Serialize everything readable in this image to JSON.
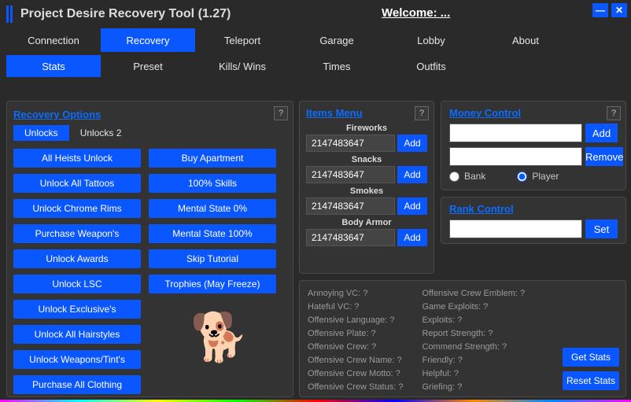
{
  "titlebar": {
    "title": "Project Desire Recovery Tool (1.27)",
    "welcome": "Welcome: ..."
  },
  "win": {
    "min": "—",
    "close": "✕"
  },
  "mainTabs": [
    "Connection",
    "Recovery",
    "Teleport",
    "Garage",
    "Lobby",
    "About"
  ],
  "mainActive": 1,
  "subTabs": [
    "Stats",
    "Preset",
    "Kills/ Wins",
    "Times",
    "Outfits"
  ],
  "subActive": 0,
  "recovery": {
    "title": "Recovery Options",
    "innerTabs": [
      "Unlocks",
      "Unlocks 2"
    ],
    "innerActive": 0,
    "col1": [
      "All Heists Unlock",
      "Unlock All Tattoos",
      "Unlock Chrome Rims",
      "Purchase Weapon's",
      "Unlock Awards",
      "Unlock LSC",
      "Unlock Exclusive's",
      "Unlock All Hairstyles",
      "Unlock Weapons/Tint's",
      "Purchase All Clothing"
    ],
    "col2": [
      "Buy Apartment",
      "100% Skills",
      "Mental State 0%",
      "Mental State 100%",
      "Skip Tutorial",
      "Trophies (May Freeze)"
    ]
  },
  "items": {
    "title": "Items Menu",
    "rows": [
      {
        "label": "Fireworks",
        "value": "2147483647",
        "btn": "Add"
      },
      {
        "label": "Snacks",
        "value": "2147483647",
        "btn": "Add"
      },
      {
        "label": "Smokes",
        "value": "2147483647",
        "btn": "Add"
      },
      {
        "label": "Body Armor",
        "value": "2147483647",
        "btn": "Add"
      }
    ]
  },
  "money": {
    "title": "Money Control",
    "add": "Add",
    "remove": "Remove",
    "bank": "Bank",
    "player": "Player"
  },
  "rank": {
    "title": "Rank Control",
    "set": "Set"
  },
  "stats": {
    "col1": [
      "Annoying VC: ?",
      "Hateful VC: ?",
      "Offensive Language: ?",
      "Offensive Plate: ?",
      "Offensive Crew: ?",
      "Offensive Crew Name: ?",
      "Offensive Crew Motto: ?",
      "Offensive Crew Status: ?"
    ],
    "col2": [
      "Offensive Crew Emblem: ?",
      "Game Exploits: ?",
      "Exploits: ?",
      "Report Strength: ?",
      "Commend Strength: ?",
      "Friendly: ?",
      "Helpful: ?",
      "Griefing: ?"
    ],
    "get": "Get Stats",
    "reset": "Reset Stats"
  },
  "help": "?"
}
